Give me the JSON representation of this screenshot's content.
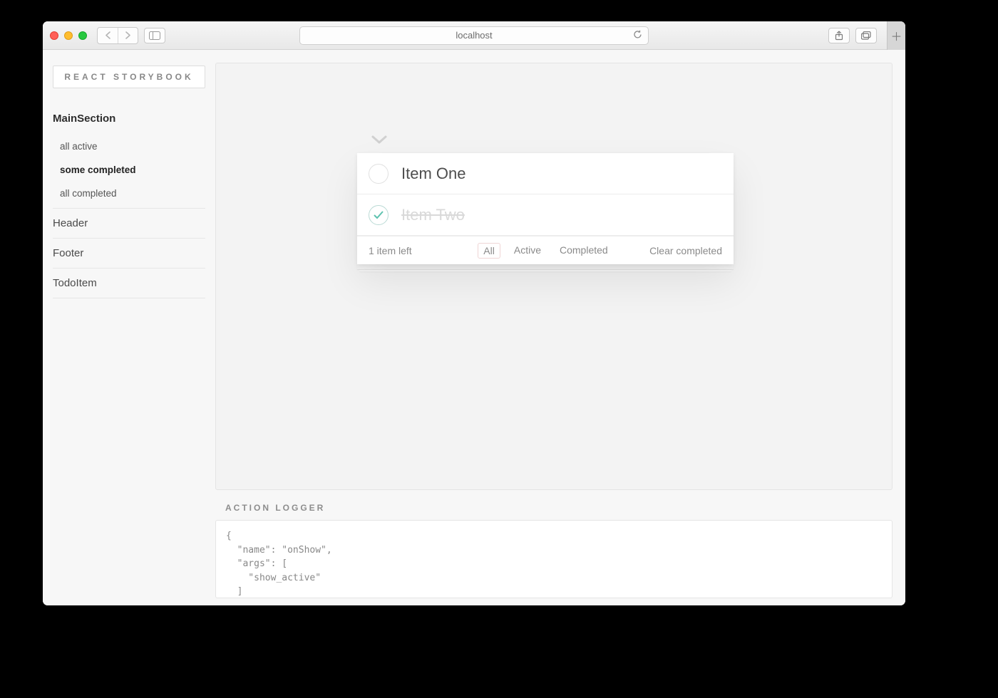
{
  "browser": {
    "address": "localhost"
  },
  "sidebar": {
    "brand": "REACT STORYBOOK",
    "groups": [
      {
        "title": "MainSection",
        "expanded": true,
        "stories": [
          {
            "label": "all active",
            "selected": false
          },
          {
            "label": "some completed",
            "selected": true
          },
          {
            "label": "all completed",
            "selected": false
          }
        ]
      },
      {
        "title": "Header",
        "expanded": false
      },
      {
        "title": "Footer",
        "expanded": false
      },
      {
        "title": "TodoItem",
        "expanded": false
      }
    ]
  },
  "todo": {
    "items": [
      {
        "label": "Item One",
        "completed": false
      },
      {
        "label": "Item Two",
        "completed": true
      }
    ],
    "count_text": "1 item left",
    "filters": {
      "all": "All",
      "active": "Active",
      "completed": "Completed",
      "selected": "all"
    },
    "clear_label": "Clear completed"
  },
  "logger": {
    "title": "ACTION LOGGER",
    "content": "{\n  \"name\": \"onShow\",\n  \"args\": [\n    \"show_active\"\n  ]\n}\n\n{"
  }
}
